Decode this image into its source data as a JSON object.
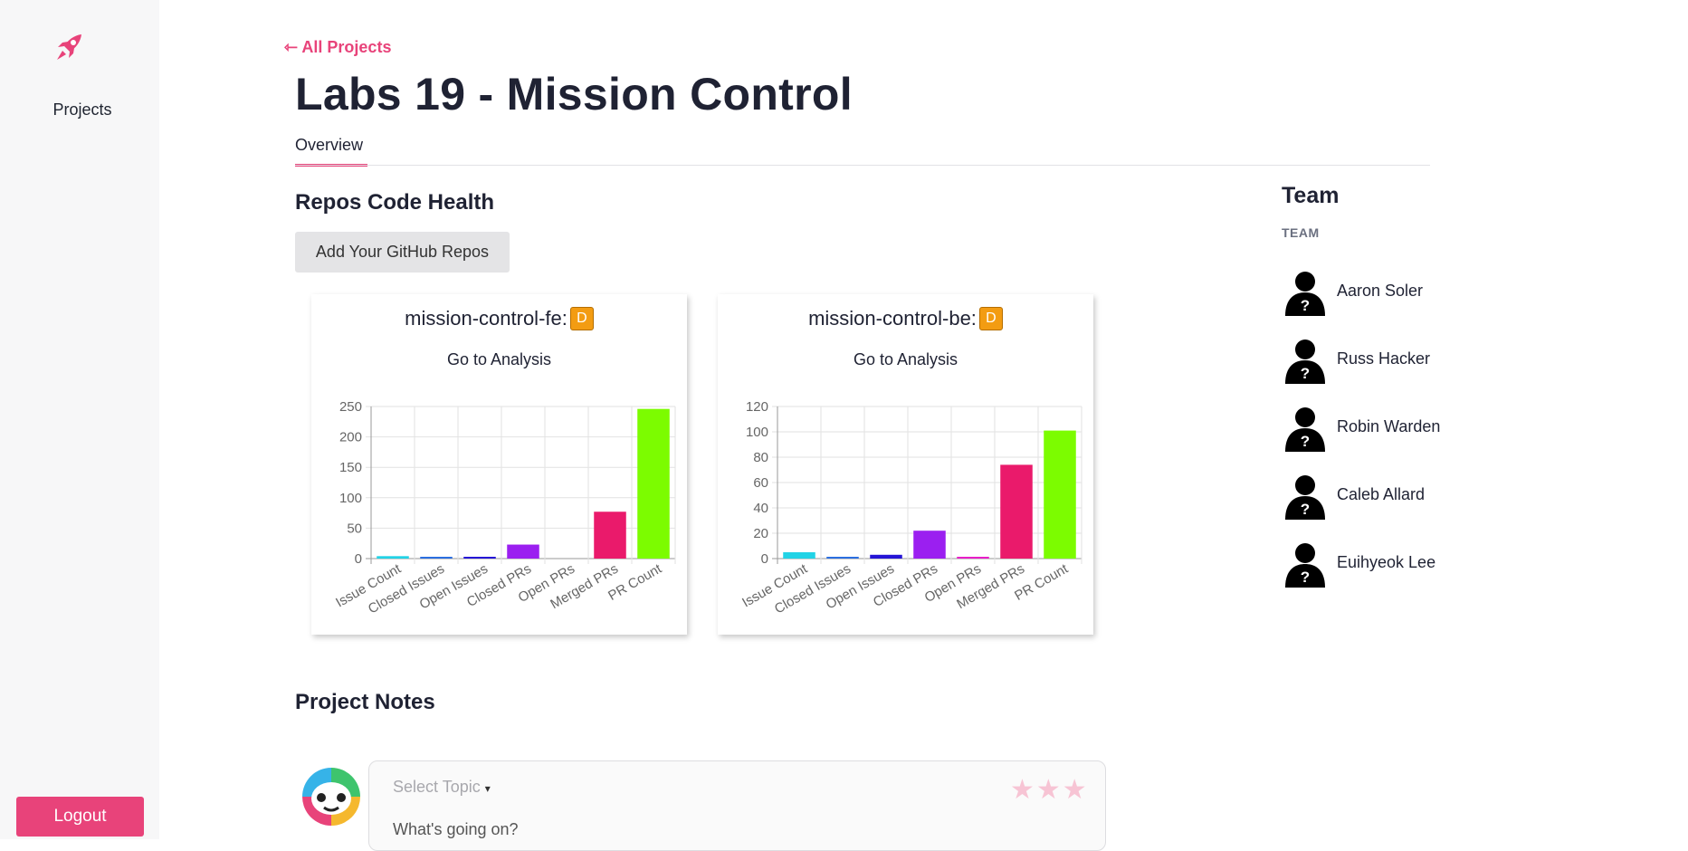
{
  "sidebar": {
    "logo_icon": "rocket-icon",
    "nav_projects": "Projects",
    "logout": "Logout",
    "accent": "#e8437a"
  },
  "header": {
    "back_link": "⇽ All Projects",
    "title": "Labs 19 - Mission Control",
    "tab_overview": "Overview"
  },
  "repos": {
    "heading": "Repos Code Health",
    "add_button": "Add Your GitHub Repos"
  },
  "cards": [
    {
      "title": "mission-control-fe:",
      "grade": "D",
      "link": "Go to Analysis"
    },
    {
      "title": "mission-control-be:",
      "grade": "D",
      "link": "Go to Analysis"
    }
  ],
  "chart_data": [
    {
      "type": "bar",
      "categories": [
        "Issue Count",
        "Closed Issues",
        "Open Issues",
        "Closed PRs",
        "Open PRs",
        "Merged PRs",
        "PR Count"
      ],
      "values": [
        4,
        1,
        2,
        23,
        0,
        77,
        246
      ],
      "colors": [
        "#22d3e6",
        "#2b6fe0",
        "#2515d6",
        "#9b1ff0",
        "#e81ec8",
        "#ea1a6b",
        "#7cfc00"
      ],
      "ylim": [
        0,
        250
      ],
      "yticks": [
        0,
        50,
        100,
        150,
        200,
        250
      ],
      "grid": true
    },
    {
      "type": "bar",
      "categories": [
        "Issue Count",
        "Closed Issues",
        "Open Issues",
        "Closed PRs",
        "Open PRs",
        "Merged PRs",
        "PR Count"
      ],
      "values": [
        5,
        1,
        3,
        22,
        1,
        74,
        101
      ],
      "colors": [
        "#22d3e6",
        "#2b6fe0",
        "#2515d6",
        "#9b1ff0",
        "#e81ec8",
        "#ea1a6b",
        "#7cfc00"
      ],
      "ylim": [
        0,
        120
      ],
      "yticks": [
        0,
        20,
        40,
        60,
        80,
        100,
        120
      ],
      "grid": true
    }
  ],
  "team": {
    "heading": "Team",
    "subheading": "TEAM",
    "members": [
      "Aaron Soler",
      "Russ Hacker",
      "Robin Warden",
      "Caleb Allard",
      "Euihyeok Lee"
    ]
  },
  "notes": {
    "heading": "Project Notes",
    "topic": "Select Topic",
    "stars": "★★★",
    "placeholder": "What's going on?"
  }
}
